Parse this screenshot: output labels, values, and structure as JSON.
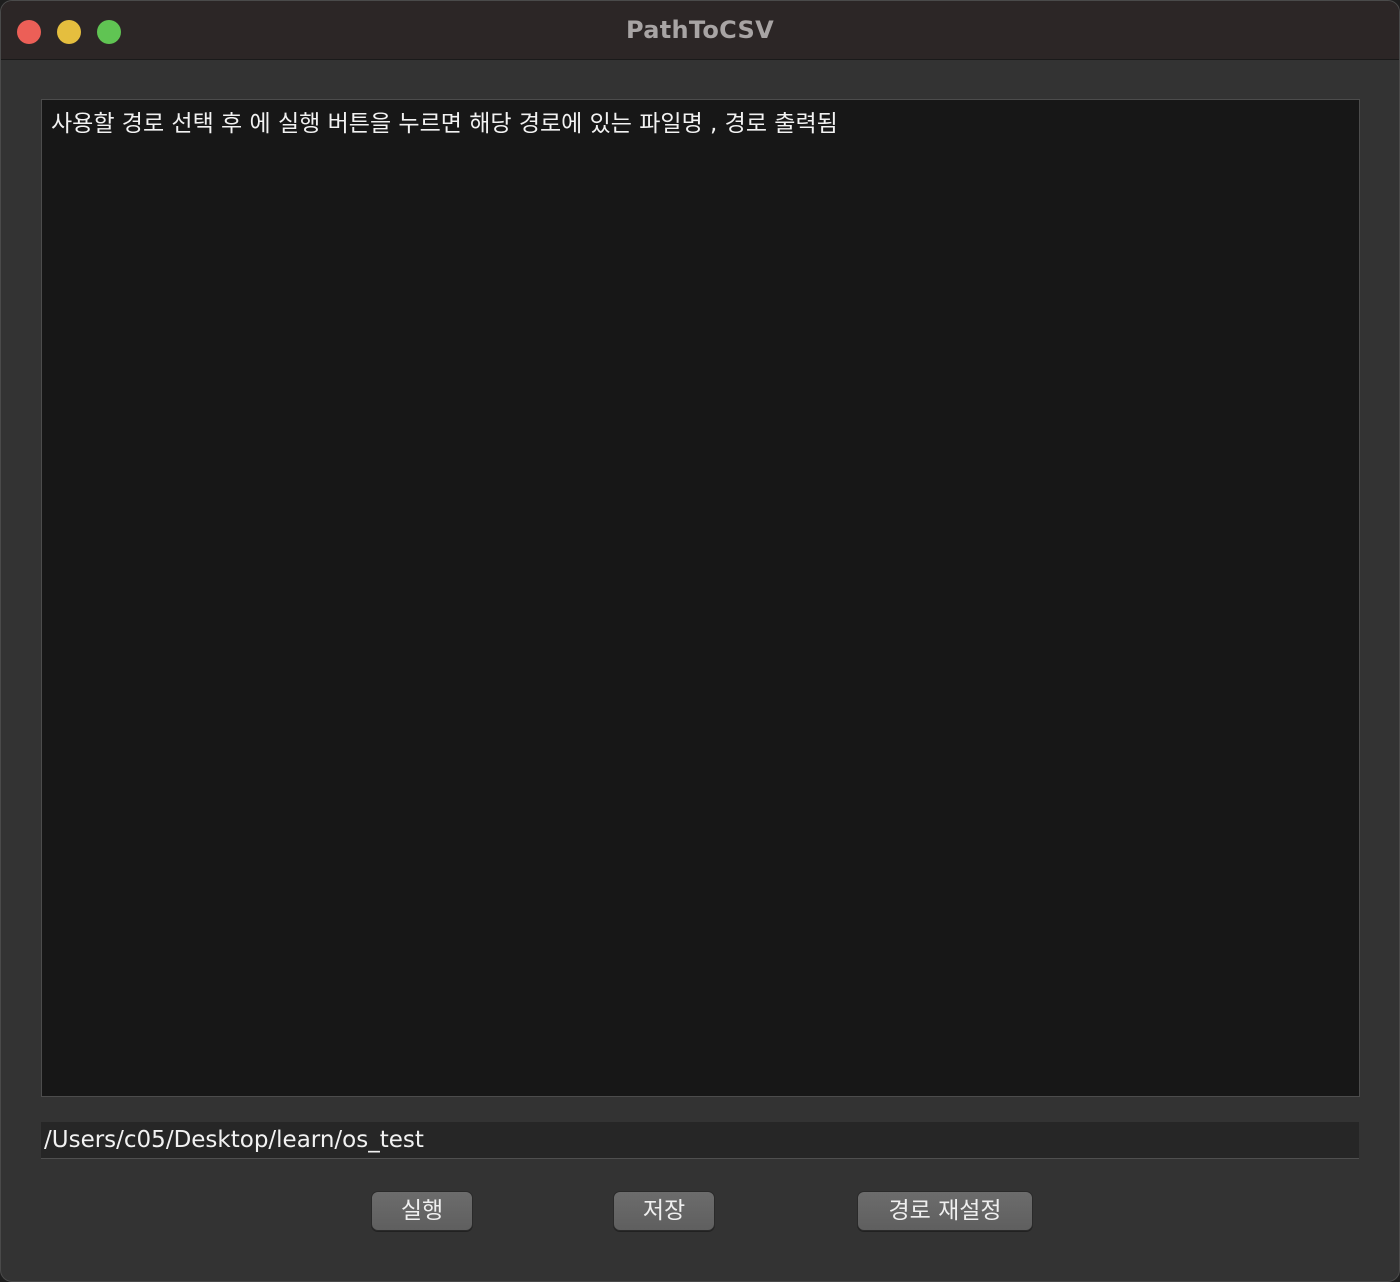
{
  "window": {
    "title": "PathToCSV"
  },
  "colors": {
    "close": "#ec5f57",
    "minimize": "#e5be3e",
    "zoom": "#60c453"
  },
  "output": {
    "text": "사용할 경로 선택 후 에 실행 버튼을 누르면 해당 경로에 있는 파일명 , 경로 출력됨"
  },
  "path_field": {
    "value": "/Users/c05/Desktop/learn/os_test"
  },
  "buttons": {
    "run": "실행",
    "save": "저장",
    "reset_path": "경로 재설정"
  }
}
